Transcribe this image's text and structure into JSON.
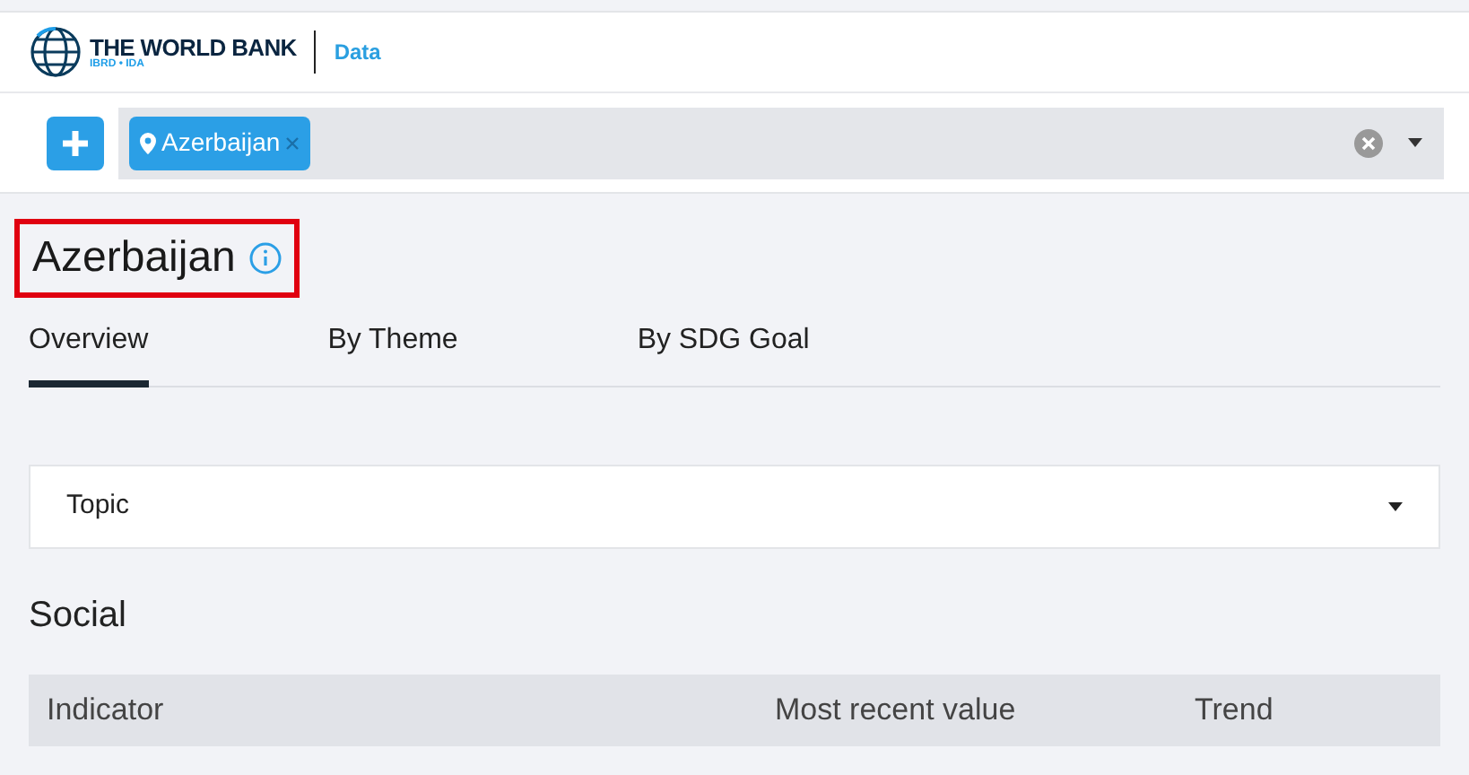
{
  "header": {
    "brand": "THE WORLD BANK",
    "brand_sub": "IBRD • IDA",
    "section": "Data"
  },
  "search": {
    "tags": [
      {
        "label": "Azerbaijan"
      }
    ]
  },
  "title": {
    "text": "Azerbaijan",
    "highlighted": true
  },
  "tabs": [
    {
      "label": "Overview",
      "selected": true
    },
    {
      "label": "By Theme",
      "selected": false
    },
    {
      "label": "By SDG Goal",
      "selected": false
    }
  ],
  "topic_dropdown": {
    "label": "Topic"
  },
  "section_heading": "Social",
  "table": {
    "columns": [
      "Indicator",
      "Most recent value",
      "Trend"
    ]
  }
}
